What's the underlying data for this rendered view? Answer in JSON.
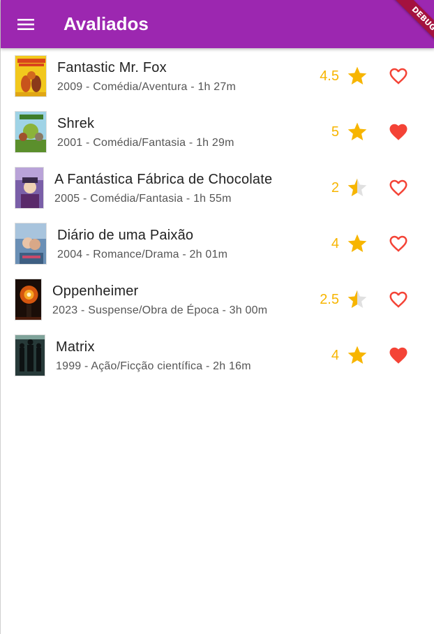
{
  "appbar": {
    "title": "Avaliados",
    "menu_icon": "menu-icon",
    "debug_label": "DEBUG"
  },
  "colors": {
    "appbar": "#9c27b0",
    "star": "#f7b500",
    "heart": "#f44336"
  },
  "movies": [
    {
      "title": "Fantastic Mr. Fox",
      "subtitle": "2009 - Comédia/Aventura - 1h 27m",
      "rating": "4.5",
      "favorite": false
    },
    {
      "title": "Shrek",
      "subtitle": "2001 - Comédia/Fantasia - 1h 29m",
      "rating": "5",
      "favorite": true
    },
    {
      "title": "A Fantástica Fábrica de Chocolate",
      "subtitle": "2005 - Comédia/Fantasia - 1h 55m",
      "rating": "2",
      "favorite": false
    },
    {
      "title": "Diário de uma Paixão",
      "subtitle": "2004 - Romance/Drama - 2h 01m",
      "rating": "4",
      "favorite": false
    },
    {
      "title": "Oppenheimer",
      "subtitle": "2023 - Suspense/Obra de Época - 3h 00m",
      "rating": "2.5",
      "favorite": false
    },
    {
      "title": "Matrix",
      "subtitle": "1999 - Ação/Ficção científica - 2h 16m",
      "rating": "4",
      "favorite": true
    }
  ]
}
